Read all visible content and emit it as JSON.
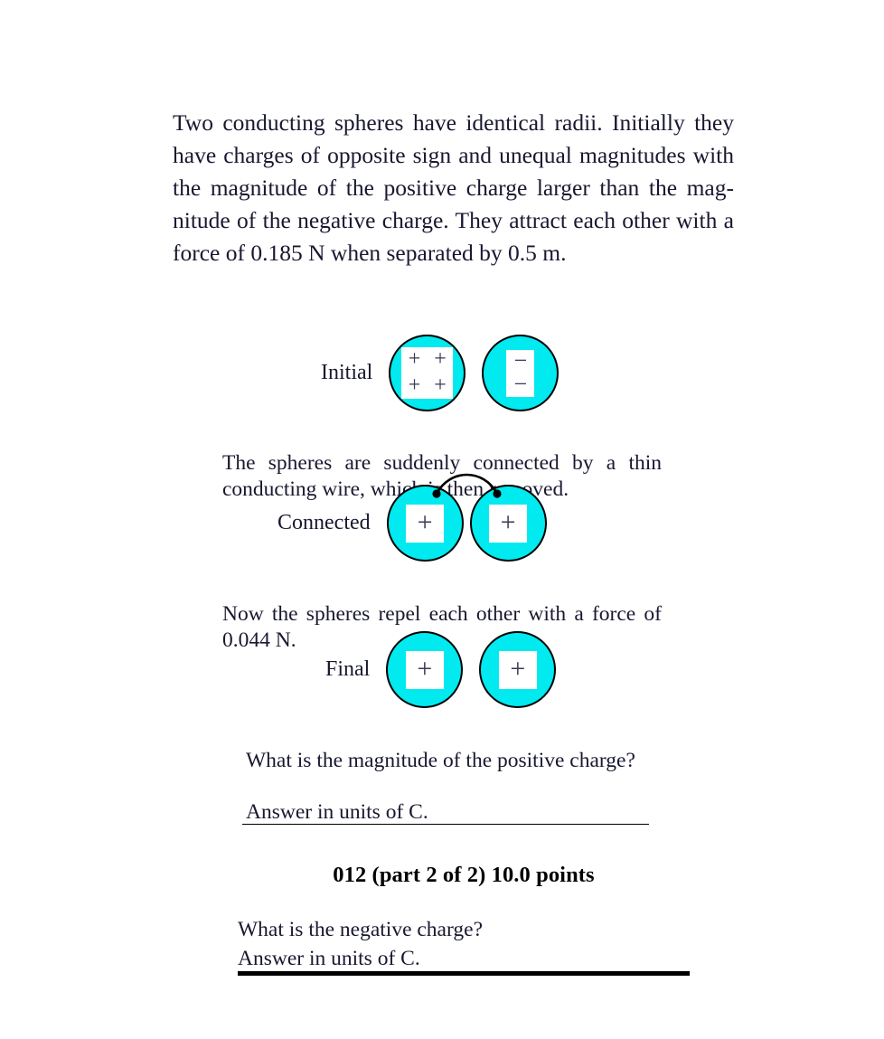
{
  "document": {
    "intro_paragraph": "Two conducting spheres have identical radii. Initially they have charges of opposite sign and unequal magnitudes with the magnitude of the positive charge larger than the mag­nitude of the negative charge. They attract each other with a force of 0.185 N when sepa­rated by 0.5 m.",
    "wire_paragraph": "The spheres are suddenly connected by a thin conducting wire, which is then removed.",
    "repel_paragraph": "Now the spheres repel each other with a force of 0.044 N.",
    "question_part1": "What is the magnitude of the positive charge?",
    "answer_units_1": "Answer in units of  C.",
    "heading_part2": "012 (part 2 of 2) 10.0 points",
    "question_part2": "What is the negative charge?",
    "answer_units_2": "Answer in units of  C."
  },
  "diagrams": {
    "initial": {
      "label": "Initial",
      "left_sphere": {
        "symbols": [
          "+",
          "+",
          "+",
          "+"
        ],
        "box": "plus4"
      },
      "right_sphere": {
        "symbols": [
          "−",
          "−"
        ],
        "box": "minus2"
      }
    },
    "connected": {
      "label": "Connected",
      "left_sphere": {
        "symbols": [
          "+"
        ],
        "box": "plus1"
      },
      "right_sphere": {
        "symbols": [
          "+"
        ],
        "box": "plus1"
      },
      "wire": "conducting-wire-arc"
    },
    "final": {
      "label": "Final",
      "left_sphere": {
        "symbols": [
          "+"
        ],
        "box": "plus1"
      },
      "right_sphere": {
        "symbols": [
          "+"
        ],
        "box": "plus1"
      }
    }
  },
  "values": {
    "attract_force": "0.185 N",
    "separation": "0.5 m",
    "repel_force": "0.044 N",
    "points": "10.0 points",
    "problem_number": "012",
    "part": "part 2 of 2",
    "units": "C"
  },
  "colors": {
    "sphere_fill": "#00eaf0",
    "sphere_outline": "#000000",
    "text": "#181830",
    "rule": "#000000",
    "charge_box": "#ffffff"
  }
}
